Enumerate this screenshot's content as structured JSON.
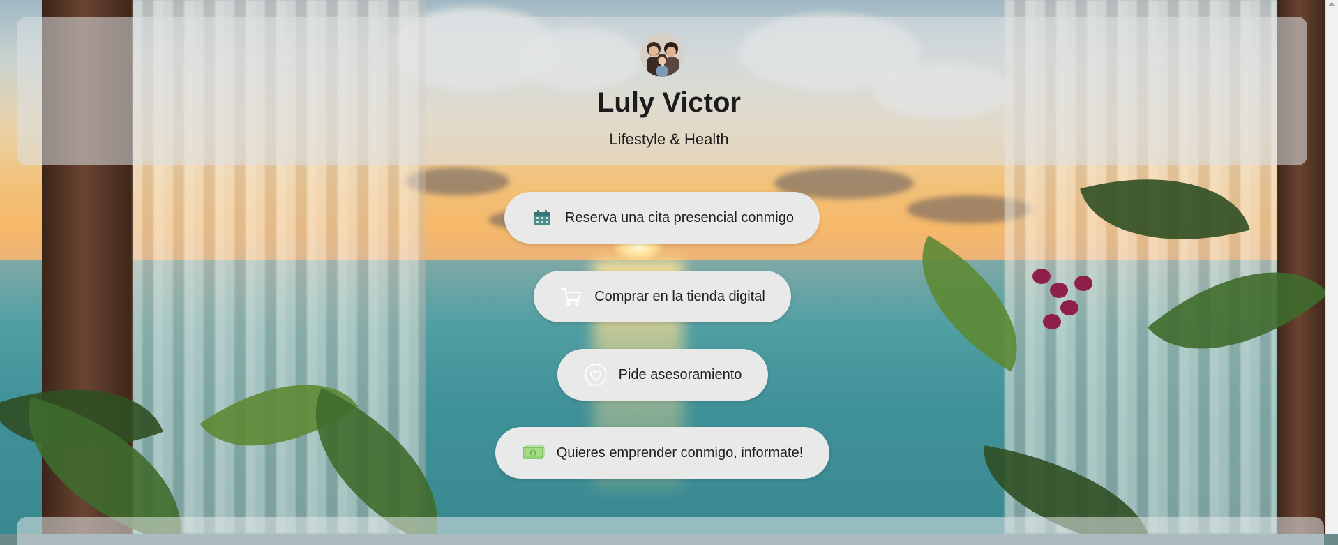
{
  "profile": {
    "name": "Luly Victor",
    "tagline": "Lifestyle & Health"
  },
  "links": [
    {
      "label": "Reserva una cita presencial conmigo",
      "icon": "calendar-icon"
    },
    {
      "label": "Comprar en la tienda digital",
      "icon": "shopping-cart-icon"
    },
    {
      "label": "Pide asesoramiento",
      "icon": "heart-badge-icon"
    },
    {
      "label": "Quieres emprender conmigo, informate!",
      "icon": "money-bill-icon"
    }
  ],
  "colors": {
    "button_bg": "#e9e9e9",
    "text": "#1e1e1e",
    "calendar_icon": "#4a8c8c",
    "money_icon": "#6bbf4a"
  }
}
